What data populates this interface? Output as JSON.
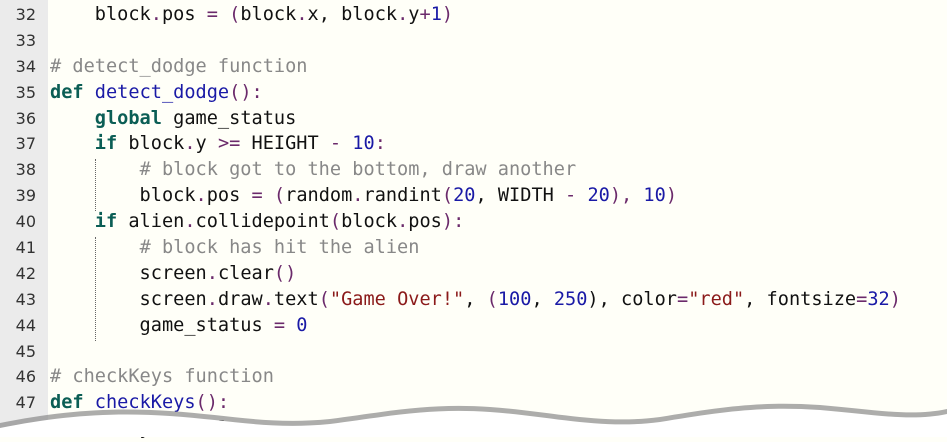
{
  "editor": {
    "colors": {
      "gutter": "#ebebeb",
      "background": "#fffff8",
      "keyword": "#0b5e55",
      "function": "#1a1aa6",
      "string": "#8b1a1a",
      "comment": "#888888"
    },
    "lines": [
      {
        "num": "32",
        "tokens": [
          {
            "t": "    block",
            "c": ""
          },
          {
            "t": ".",
            "c": "op"
          },
          {
            "t": "pos ",
            "c": ""
          },
          {
            "t": "=",
            "c": "op"
          },
          {
            "t": " ",
            "c": ""
          },
          {
            "t": "(",
            "c": "op"
          },
          {
            "t": "block",
            "c": ""
          },
          {
            "t": ".",
            "c": "op"
          },
          {
            "t": "x, block",
            "c": ""
          },
          {
            "t": ".",
            "c": "op"
          },
          {
            "t": "y",
            "c": ""
          },
          {
            "t": "+",
            "c": "op"
          },
          {
            "t": "1",
            "c": "num"
          },
          {
            "t": ")",
            "c": "op"
          }
        ]
      },
      {
        "num": "33",
        "tokens": []
      },
      {
        "num": "34",
        "tokens": [
          {
            "t": "# detect_dodge function",
            "c": "cmt"
          }
        ]
      },
      {
        "num": "35",
        "tokens": [
          {
            "t": "def",
            "c": "kw"
          },
          {
            "t": " ",
            "c": ""
          },
          {
            "t": "detect_dodge",
            "c": "fn"
          },
          {
            "t": "():",
            "c": "op"
          }
        ]
      },
      {
        "num": "36",
        "tokens": [
          {
            "t": "    ",
            "c": ""
          },
          {
            "t": "global",
            "c": "kw"
          },
          {
            "t": " game_status",
            "c": ""
          }
        ]
      },
      {
        "num": "37",
        "tokens": [
          {
            "t": "    ",
            "c": ""
          },
          {
            "t": "if",
            "c": "kw"
          },
          {
            "t": " block",
            "c": ""
          },
          {
            "t": ".",
            "c": "op"
          },
          {
            "t": "y ",
            "c": ""
          },
          {
            "t": ">=",
            "c": "op"
          },
          {
            "t": " HEIGHT ",
            "c": ""
          },
          {
            "t": "-",
            "c": "op"
          },
          {
            "t": " ",
            "c": ""
          },
          {
            "t": "10",
            "c": "num"
          },
          {
            "t": ":",
            "c": "op"
          }
        ]
      },
      {
        "num": "38",
        "tokens": [
          {
            "t": "        ",
            "c": ""
          },
          {
            "t": "# block got to the bottom, draw another",
            "c": "cmt"
          }
        ]
      },
      {
        "num": "39",
        "tokens": [
          {
            "t": "        block",
            "c": ""
          },
          {
            "t": ".",
            "c": "op"
          },
          {
            "t": "pos ",
            "c": ""
          },
          {
            "t": "=",
            "c": "op"
          },
          {
            "t": " ",
            "c": ""
          },
          {
            "t": "(",
            "c": "op"
          },
          {
            "t": "random",
            "c": ""
          },
          {
            "t": ".",
            "c": "op"
          },
          {
            "t": "randint",
            "c": ""
          },
          {
            "t": "(",
            "c": "op"
          },
          {
            "t": "20",
            "c": "num"
          },
          {
            "t": ", WIDTH ",
            "c": ""
          },
          {
            "t": "-",
            "c": "op"
          },
          {
            "t": " ",
            "c": ""
          },
          {
            "t": "20",
            "c": "num"
          },
          {
            "t": "), ",
            "c": "op"
          },
          {
            "t": "10",
            "c": "num"
          },
          {
            "t": ")",
            "c": "op"
          }
        ]
      },
      {
        "num": "40",
        "tokens": [
          {
            "t": "    ",
            "c": ""
          },
          {
            "t": "if",
            "c": "kw"
          },
          {
            "t": " alien",
            "c": ""
          },
          {
            "t": ".",
            "c": "op"
          },
          {
            "t": "collidepoint",
            "c": ""
          },
          {
            "t": "(",
            "c": "op"
          },
          {
            "t": "block",
            "c": ""
          },
          {
            "t": ".",
            "c": "op"
          },
          {
            "t": "pos",
            "c": ""
          },
          {
            "t": "):",
            "c": "op"
          }
        ]
      },
      {
        "num": "41",
        "tokens": [
          {
            "t": "        ",
            "c": ""
          },
          {
            "t": "# block has hit the alien",
            "c": "cmt"
          }
        ]
      },
      {
        "num": "42",
        "tokens": [
          {
            "t": "        screen",
            "c": ""
          },
          {
            "t": ".",
            "c": "op"
          },
          {
            "t": "clear",
            "c": ""
          },
          {
            "t": "()",
            "c": "op"
          }
        ]
      },
      {
        "num": "43",
        "tokens": [
          {
            "t": "        screen",
            "c": ""
          },
          {
            "t": ".",
            "c": "op"
          },
          {
            "t": "draw",
            "c": ""
          },
          {
            "t": ".",
            "c": "op"
          },
          {
            "t": "text",
            "c": ""
          },
          {
            "t": "(",
            "c": "op"
          },
          {
            "t": "\"Game Over!\"",
            "c": "str"
          },
          {
            "t": ", ",
            "c": ""
          },
          {
            "t": "(",
            "c": "op"
          },
          {
            "t": "100",
            "c": "num"
          },
          {
            "t": ", ",
            "c": ""
          },
          {
            "t": "250",
            "c": "num"
          },
          {
            "t": "), color",
            "c": ""
          },
          {
            "t": "=",
            "c": "op"
          },
          {
            "t": "\"red\"",
            "c": "str"
          },
          {
            "t": ", fontsize",
            "c": ""
          },
          {
            "t": "=",
            "c": "op"
          },
          {
            "t": "32",
            "c": "num"
          },
          {
            "t": ")",
            "c": "op"
          }
        ]
      },
      {
        "num": "44",
        "tokens": [
          {
            "t": "        game_status ",
            "c": ""
          },
          {
            "t": "=",
            "c": "op"
          },
          {
            "t": " ",
            "c": ""
          },
          {
            "t": "0",
            "c": "num"
          }
        ]
      },
      {
        "num": "45",
        "tokens": []
      },
      {
        "num": "46",
        "tokens": [
          {
            "t": "# checkKeys function",
            "c": "cmt"
          }
        ]
      },
      {
        "num": "47",
        "tokens": [
          {
            "t": "def",
            "c": "kw"
          },
          {
            "t": " ",
            "c": ""
          },
          {
            "t": "checkKeys",
            "c": "fn"
          },
          {
            "t": "():",
            "c": "op"
          }
        ]
      },
      {
        "num": "",
        "tokens": [
          {
            "t": "      keyboard.l",
            "c": ""
          }
        ]
      }
    ]
  }
}
